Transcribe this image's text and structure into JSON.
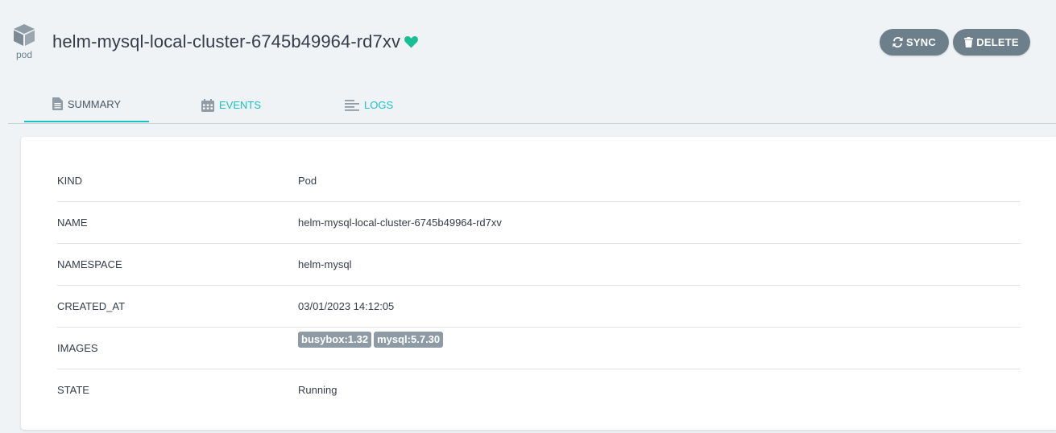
{
  "header": {
    "kind_label": "pod",
    "title": "helm-mysql-local-cluster-6745b49964-rd7xv",
    "health_color": "#18be94",
    "sync_label": "SYNC",
    "delete_label": "DELETE"
  },
  "tabs": [
    {
      "label": "SUMMARY",
      "icon": "file-icon",
      "active": true
    },
    {
      "label": "EVENTS",
      "icon": "calendar-icon",
      "active": false
    },
    {
      "label": "LOGS",
      "icon": "align-left-icon",
      "active": false
    }
  ],
  "summary": {
    "rows": [
      {
        "key": "KIND",
        "value": "Pod"
      },
      {
        "key": "NAME",
        "value": "helm-mysql-local-cluster-6745b49964-rd7xv"
      },
      {
        "key": "NAMESPACE",
        "value": "helm-mysql"
      },
      {
        "key": "CREATED_AT",
        "value": "03/01/2023 14:12:05"
      },
      {
        "key": "IMAGES",
        "images": [
          "busybox:1.32",
          "mysql:5.7.30"
        ]
      },
      {
        "key": "STATE",
        "value": "Running"
      }
    ]
  },
  "colors": {
    "accent": "#1ac0c8",
    "button_bg": "#6d7f8b",
    "page_bg": "#eff3f6"
  }
}
